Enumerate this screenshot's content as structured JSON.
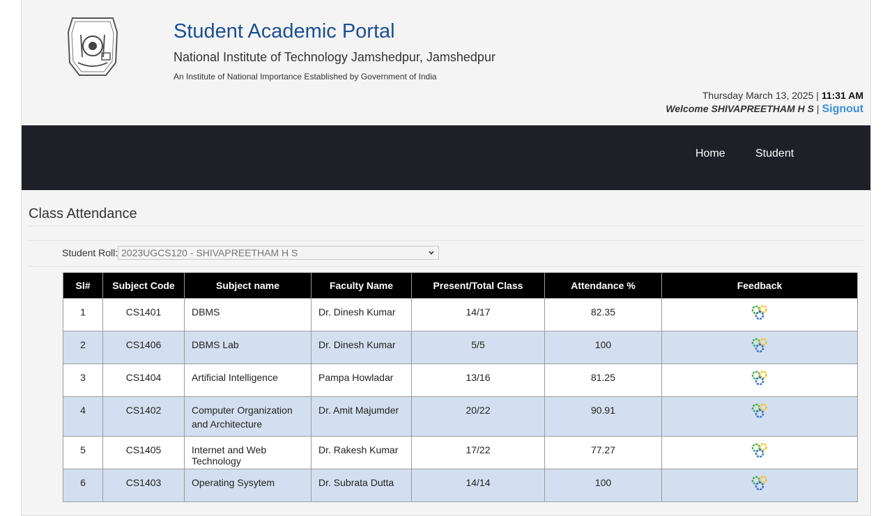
{
  "header": {
    "title": "Student Academic Portal",
    "institute": "National Institute of Technology Jamshedpur, Jamshedpur",
    "tagline": "An Institute of National Importance Established by Government of India",
    "date": "Thursday March 13, 2025",
    "separator": "|",
    "time": "11:31 AM",
    "welcome": "Welcome SHIVAPREETHAM H S",
    "signout": "Signout"
  },
  "nav": {
    "home": "Home",
    "student": "Student"
  },
  "page": {
    "heading": "Class Attendance",
    "roll_label": "Student Roll:",
    "roll_value": "2023UGCS120 - SHIVAPREETHAM H S"
  },
  "table": {
    "headers": [
      "Sl#",
      "Subject Code",
      "Subject name",
      "Faculty Name",
      "Present/Total Class",
      "Attendance %",
      "Feedback"
    ],
    "rows": [
      {
        "sl": "1",
        "code": "CS1401",
        "subject": "DBMS",
        "faculty": "Dr. Dinesh Kumar",
        "present": "14/17",
        "percent": "82.35"
      },
      {
        "sl": "2",
        "code": "CS1406",
        "subject": "DBMS Lab",
        "faculty": "Dr. Dinesh Kumar",
        "present": "5/5",
        "percent": "100"
      },
      {
        "sl": "3",
        "code": "CS1404",
        "subject": "Artificial Intelligence",
        "faculty": "Pampa Howladar",
        "present": "13/16",
        "percent": "81.25"
      },
      {
        "sl": "4",
        "code": "CS1402",
        "subject": "Computer Organization and Architecture",
        "faculty": "Dr. Amit Majumder",
        "present": "20/22",
        "percent": "90.91"
      },
      {
        "sl": "5",
        "code": "CS1405",
        "subject": "Internet and Web Technology",
        "faculty": "Dr. Rakesh Kumar",
        "present": "17/22",
        "percent": "77.27"
      },
      {
        "sl": "6",
        "code": "CS1403",
        "subject": "Operating Sysytem",
        "faculty": "Dr. Subrata Dutta",
        "present": "14/14",
        "percent": "100"
      }
    ]
  },
  "icons": {
    "logo": "institute-emblem-icon",
    "feedback": "feedback-gears-icon",
    "dropdown": "chevron-down-icon"
  },
  "colors": {
    "title": "#1b4f93",
    "navbar": "#1f1f27",
    "signout": "#3a8fd8",
    "row_alt": "#d3dff0"
  }
}
